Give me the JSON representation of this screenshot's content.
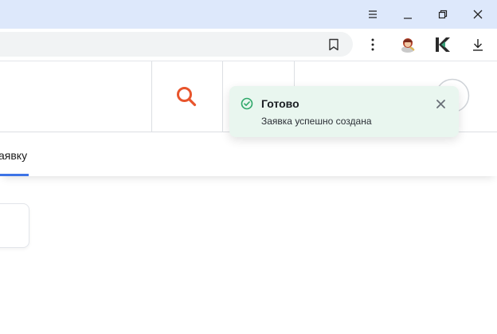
{
  "window_controls": {
    "menu_icon": "menu-icon",
    "minimize_icon": "minimize-icon",
    "restore_icon": "restore-icon",
    "close_icon": "close-icon"
  },
  "toolbar": {
    "bookmark_icon": "bookmark-icon",
    "more_icon": "more-vertical-icon",
    "extension_1_icon": "extension-avatar-icon",
    "extension_2_icon": "kinopoisk-k-icon",
    "download_icon": "download-icon"
  },
  "header": {
    "search_icon": "search-icon",
    "search_color": "#e8542c"
  },
  "tabs": {
    "active_label": "аявку",
    "accent_color": "#3d74e6"
  },
  "toast": {
    "title": "Готово",
    "message": "Заявка успешно создана",
    "status_icon": "check-circle-icon",
    "close_icon": "close-icon",
    "success_color": "#2fa86a",
    "background": "#e9f6ef"
  }
}
